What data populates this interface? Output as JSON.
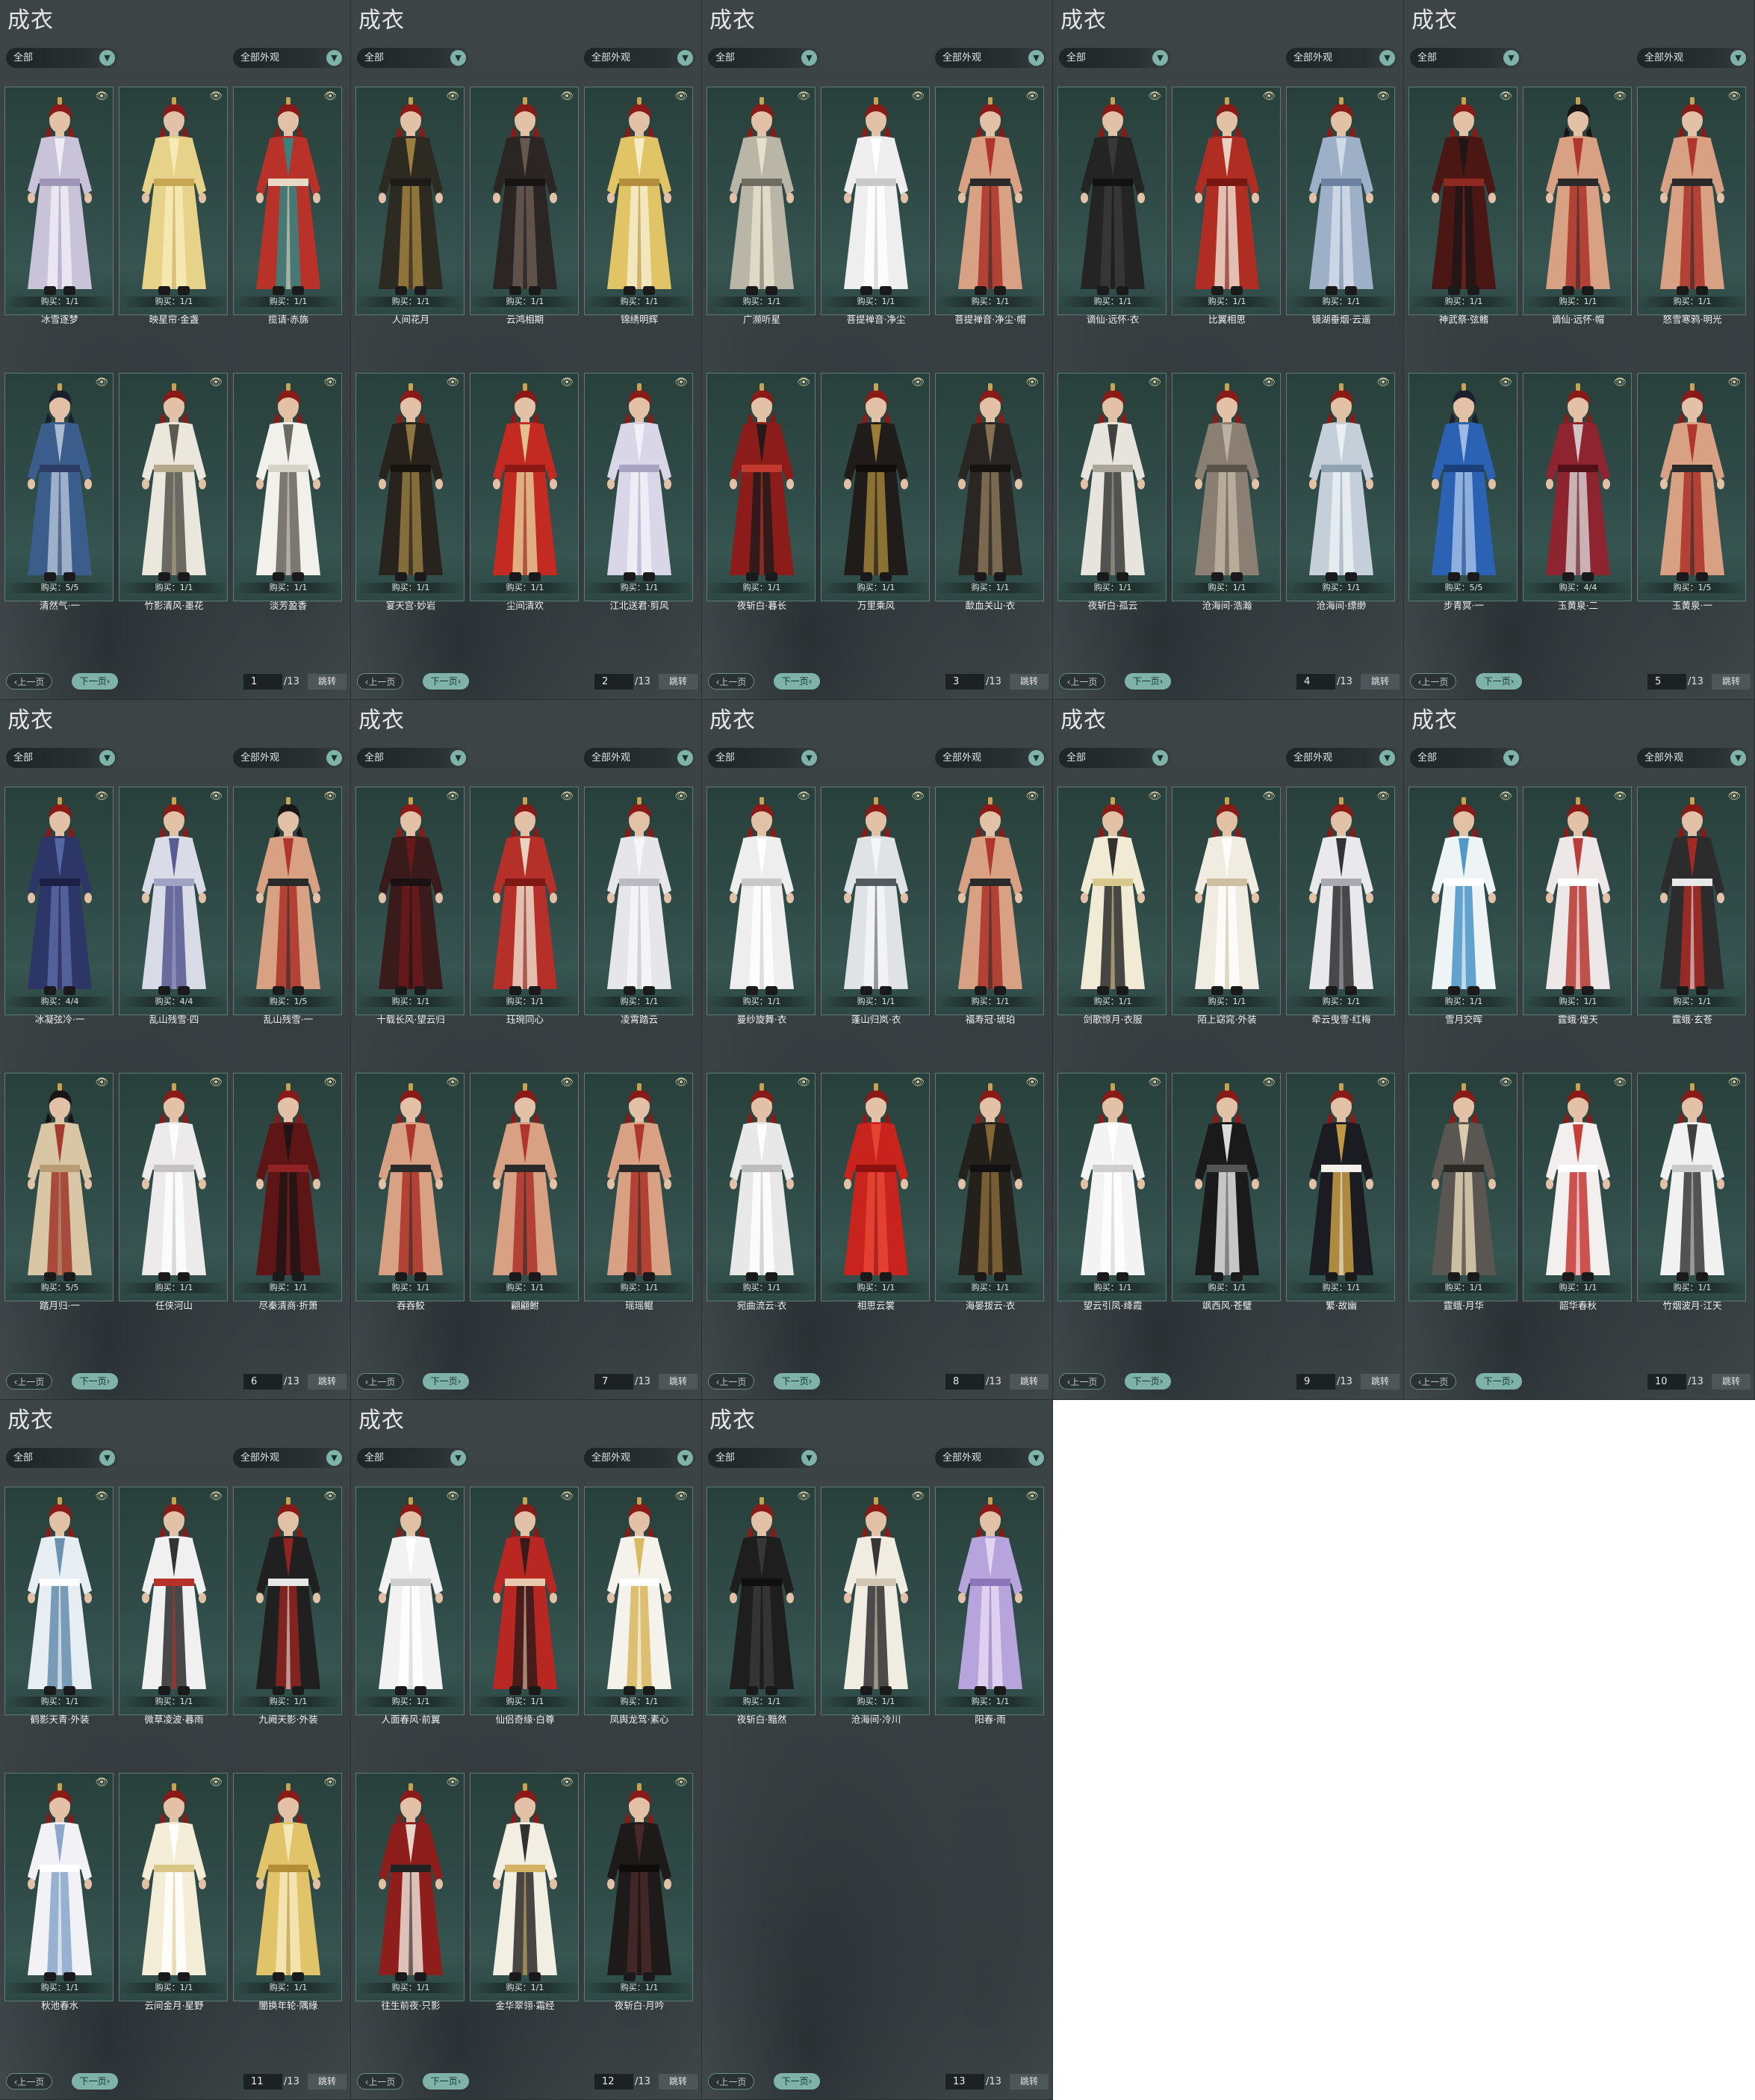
{
  "app": {
    "title": "成衣",
    "filter_left": "全部",
    "filter_right": "全部外观",
    "prev_label": "上一页",
    "next_label": "下一页",
    "jump_label": "跳转",
    "total_pages": "/13",
    "eye_icon": "eye-icon",
    "dropdown_icon": "chevron-down-icon"
  },
  "panels": [
    {
      "page": "1",
      "items": [
        {
          "name": "冰雪逐梦",
          "buy": "购买：1/1",
          "hair": "#8a1a16",
          "outfit": [
            "#c9c3d9",
            "#f1eff6",
            "#9d96b8"
          ]
        },
        {
          "name": "映星帘·金盏",
          "buy": "购买：1/1",
          "hair": "#8a1a16",
          "outfit": [
            "#e7d28a",
            "#f7ecb9",
            "#c7a754"
          ]
        },
        {
          "name": "揽请·赤旆",
          "buy": "购买：1/1",
          "hair": "#8a1a16",
          "outfit": [
            "#b8322a",
            "#2a8a86",
            "#e8d9c4"
          ]
        },
        {
          "name": "清然气·一",
          "buy": "购买：5/5",
          "hair": "#1c1f2e",
          "outfit": [
            "#3a5d8c",
            "#b7c5d8",
            "#2b3d66"
          ]
        },
        {
          "name": "竹影清风·墨花",
          "buy": "购买：1/1",
          "hair": "#8a1a16",
          "outfit": [
            "#ece7dc",
            "#4a4a44",
            "#b5a78a"
          ]
        },
        {
          "name": "淡芳盈香",
          "buy": "购买：1/1",
          "hair": "#8a1a16",
          "outfit": [
            "#f2f0ea",
            "#5c5a55",
            "#d6d2c8"
          ]
        }
      ]
    },
    {
      "page": "2",
      "items": [
        {
          "name": "人间花月",
          "buy": "购买：1/1",
          "hair": "#8a1a16",
          "outfit": [
            "#2d2a22",
            "#a68642",
            "#1d1b17"
          ]
        },
        {
          "name": "云鸿相期",
          "buy": "购买：1/1",
          "hair": "#8a1a16",
          "outfit": [
            "#2b2523",
            "#6b5e55",
            "#191515"
          ]
        },
        {
          "name": "锦绣明辉",
          "buy": "购买：1/1",
          "hair": "#8a1a16",
          "outfit": [
            "#e1c465",
            "#f6f0d2",
            "#b48e3a"
          ]
        },
        {
          "name": "宴天宫·妙岩",
          "buy": "购买：1/1",
          "hair": "#8a1a16",
          "outfit": [
            "#28231c",
            "#9a7f45",
            "#17140f"
          ]
        },
        {
          "name": "尘间清欢",
          "buy": "购买：1/1",
          "hair": "#8a1a16",
          "outfit": [
            "#c22a22",
            "#e7cf9a",
            "#8e1914"
          ]
        },
        {
          "name": "江北送君·剪风",
          "buy": "购买：1/1",
          "hair": "#8a1a16",
          "outfit": [
            "#d9d6e8",
            "#f3f2f8",
            "#a8a3c2"
          ]
        }
      ]
    },
    {
      "page": "3",
      "items": [
        {
          "name": "广濒听星",
          "buy": "购买：1/1",
          "hair": "#8a1a16",
          "outfit": [
            "#b9b6a8",
            "#e9e4cf",
            "#6f6c62"
          ]
        },
        {
          "name": "菩提禅音·净尘",
          "buy": "购买：1/1",
          "hair": "#8a1a16",
          "outfit": [
            "#eeeeee",
            "#ffffff",
            "#c9c9c9"
          ]
        },
        {
          "name": "菩提禅音·净尘·帽",
          "buy": "购买：1/1",
          "hair": "#8a1a16",
          "outfit": [
            "#d9a184",
            "#a82a22",
            "#2a2a2a"
          ]
        },
        {
          "name": "夜斩白·暮长",
          "buy": "购买：1/1",
          "hair": "#8a1a16",
          "outfit": [
            "#8b1c1a",
            "#1d1a1a",
            "#c23a2e"
          ]
        },
        {
          "name": "万里乘风",
          "buy": "购买：1/1",
          "hair": "#8a1a16",
          "outfit": [
            "#1f1c1a",
            "#a7873c",
            "#0f0e0d"
          ]
        },
        {
          "name": "歃血关山·衣",
          "buy": "购买：1/1",
          "hair": "#8a1a16",
          "outfit": [
            "#2a2624",
            "#8d7a5c",
            "#161312"
          ]
        }
      ]
    },
    {
      "page": "4",
      "items": [
        {
          "name": "谪仙·远怀·衣",
          "buy": "购买：1/1",
          "hair": "#8a1a16",
          "outfit": [
            "#242424",
            "#3b3b3b",
            "#121212"
          ]
        },
        {
          "name": "比翼相思",
          "buy": "购买：1/1",
          "hair": "#8a1a16",
          "outfit": [
            "#b02d24",
            "#efe3d3",
            "#7a1612"
          ]
        },
        {
          "name": "镜湖垂烟·云遥",
          "buy": "购买：1/1",
          "hair": "#8a1a16",
          "outfit": [
            "#9eb0c8",
            "#d6dfea",
            "#6d82a0"
          ]
        },
        {
          "name": "夜斩白·孤云",
          "buy": "购买：1/1",
          "hair": "#8a1a16",
          "outfit": [
            "#e7e4de",
            "#2d2d2d",
            "#aaa59a"
          ]
        },
        {
          "name": "沧海间·浩瀚",
          "buy": "购买：1/1",
          "hair": "#8a1a16",
          "outfit": [
            "#8a7f72",
            "#c2b7a6",
            "#5a5248"
          ]
        },
        {
          "name": "沧海间·缥缈",
          "buy": "购买：1/1",
          "hair": "#8a1a16",
          "outfit": [
            "#c4cfd9",
            "#eef2f5",
            "#91a2b2"
          ]
        }
      ]
    },
    {
      "page": "5",
      "items": [
        {
          "name": "神武祭·弦鳍",
          "buy": "购买：1/1",
          "hair": "#8a1a16",
          "outfit": [
            "#4a1714",
            "#1c1616",
            "#8f2a22"
          ]
        },
        {
          "name": "谪仙·远怀·帽",
          "buy": "购买：1/1",
          "hair": "#1a1515",
          "outfit": [
            "#d9a184",
            "#a82a22",
            "#2a2a2a"
          ]
        },
        {
          "name": "怒雪寒鸦·明光",
          "buy": "购买：1/1",
          "hair": "#8a1a16",
          "outfit": [
            "#d9a184",
            "#a82a22",
            "#2a2a2a"
          ]
        },
        {
          "name": "步青冥·一",
          "buy": "购买：5/5",
          "hair": "#1c1f2e",
          "outfit": [
            "#2c62b3",
            "#a8c4ea",
            "#1c3f7c"
          ]
        },
        {
          "name": "玉黄泉·二",
          "buy": "购买：4/4",
          "hair": "#8a1a16",
          "outfit": [
            "#8e2430",
            "#d9d6d6",
            "#541018"
          ]
        },
        {
          "name": "玉黄泉·一",
          "buy": "购买：1/5",
          "hair": "#8a1a16",
          "outfit": [
            "#d9a184",
            "#a82a22",
            "#2a2a2a"
          ]
        }
      ]
    },
    {
      "page": "6",
      "items": [
        {
          "name": "冰凝弦冷·一",
          "buy": "购买：4/4",
          "hair": "#8a1a16",
          "outfit": [
            "#2d3767",
            "#5c6aa6",
            "#1a2046"
          ]
        },
        {
          "name": "乱山残雪·四",
          "buy": "购买：4/4",
          "hair": "#8a1a16",
          "outfit": [
            "#d9dbe6",
            "#4b4f8a",
            "#9fa4c4"
          ]
        },
        {
          "name": "乱山残雪·一",
          "buy": "购买：1/5",
          "hair": "#1a1515",
          "outfit": [
            "#d9a184",
            "#a82a22",
            "#2a2a2a"
          ]
        },
        {
          "name": "踏月归·一",
          "buy": "购买：5/5",
          "hair": "#1a1515",
          "outfit": [
            "#d9c6a4",
            "#9b2a22",
            "#b79c74"
          ]
        },
        {
          "name": "任侠河山",
          "buy": "购买：1/1",
          "hair": "#8a1a16",
          "outfit": [
            "#eceaea",
            "#ffffff",
            "#c4c2c2"
          ]
        },
        {
          "name": "尽秦清商·折箫",
          "buy": "购买：1/1",
          "hair": "#8a1a16",
          "outfit": [
            "#5e1515",
            "#1a1414",
            "#8f2222"
          ]
        }
      ]
    },
    {
      "page": "7",
      "items": [
        {
          "name": "十载长风·望云归",
          "buy": "购买：1/1",
          "hair": "#8a1a16",
          "outfit": [
            "#3a1b1b",
            "#6f1a1a",
            "#1a1212"
          ]
        },
        {
          "name": "珏琬同心",
          "buy": "购买：1/1",
          "hair": "#8a1a16",
          "outfit": [
            "#b6302a",
            "#f0e4d2",
            "#7d1813"
          ]
        },
        {
          "name": "凌霄踏云",
          "buy": "购买：1/1",
          "hair": "#8a1a16",
          "outfit": [
            "#e6e6ea",
            "#f8f8fa",
            "#babac2"
          ]
        },
        {
          "name": "吞吞鲛",
          "buy": "购买：1/1",
          "hair": "#8a1a16",
          "outfit": [
            "#d9a184",
            "#a82a22",
            "#2a2a2a"
          ]
        },
        {
          "name": "翩翩鲋",
          "buy": "购买：1/1",
          "hair": "#8a1a16",
          "outfit": [
            "#d9a184",
            "#a82a22",
            "#2a2a2a"
          ]
        },
        {
          "name": "瑶瑶鲲",
          "buy": "购买：1/1",
          "hair": "#8a1a16",
          "outfit": [
            "#d9a184",
            "#a82a22",
            "#2a2a2a"
          ]
        }
      ]
    },
    {
      "page": "8",
      "items": [
        {
          "name": "曼纱旋舞·衣",
          "buy": "购买：1/1",
          "hair": "#8a1a16",
          "outfit": [
            "#eeeeee",
            "#ffffff",
            "#c8c8c8"
          ]
        },
        {
          "name": "蓬山归岚·衣",
          "buy": "购买：1/1",
          "hair": "#8a1a16",
          "outfit": [
            "#dfe3e6",
            "#f5f6f7",
            "#535a60"
          ]
        },
        {
          "name": "福寿冠·琥珀",
          "buy": "购买：1/1",
          "hair": "#8a1a16",
          "outfit": [
            "#d9a184",
            "#a82a22",
            "#2a2a2a"
          ]
        },
        {
          "name": "宛曲流云·衣",
          "buy": "购买：1/1",
          "hair": "#8a1a16",
          "outfit": [
            "#e8e8e8",
            "#ffffff",
            "#bdbdbd"
          ]
        },
        {
          "name": "相思云裳",
          "buy": "购买：1/1",
          "hair": "#8a1a16",
          "outfit": [
            "#c8231d",
            "#e84838",
            "#8d120f"
          ]
        },
        {
          "name": "海晏拔云·衣",
          "buy": "购买：1/1",
          "hair": "#8a1a16",
          "outfit": [
            "#24201c",
            "#8c6d3b",
            "#121010"
          ]
        }
      ]
    },
    {
      "page": "9",
      "items": [
        {
          "name": "剑歌惊月·衣服",
          "buy": "购买：1/1",
          "hair": "#8a1a16",
          "outfit": [
            "#f1ead4",
            "#1d1d1d",
            "#d9c88e"
          ]
        },
        {
          "name": "陌上窈窕·外装",
          "buy": "购买：1/1",
          "hair": "#8a1a16",
          "outfit": [
            "#f1ece2",
            "#ffffff",
            "#cdbf9f"
          ]
        },
        {
          "name": "牵云曳雪·红梅",
          "buy": "购买：1/1",
          "hair": "#8a1a16",
          "outfit": [
            "#e9e9ec",
            "#1f1f22",
            "#a9a9b2"
          ]
        },
        {
          "name": "望云引凤·绛霞",
          "buy": "购买：1/1",
          "hair": "#8a1a16",
          "outfit": [
            "#f3f3f3",
            "#ffffff",
            "#cfcfcf"
          ]
        },
        {
          "name": "飒西风·苍璧",
          "buy": "购买：1/1",
          "hair": "#8a1a16",
          "outfit": [
            "#1a1a1a",
            "#f1f1f1",
            "#555555"
          ]
        },
        {
          "name": "繁·故幽",
          "buy": "购买：1/1",
          "hair": "#8a1a16",
          "outfit": [
            "#1b1b22",
            "#d3a648",
            "#f2efe8"
          ]
        }
      ]
    },
    {
      "page": "10",
      "items": [
        {
          "name": "雪月交晖",
          "buy": "购买：1/1",
          "hair": "#8a1a16",
          "outfit": [
            "#eef3f6",
            "#3f8fc4",
            "#ffffff"
          ]
        },
        {
          "name": "霆蛾·煌天",
          "buy": "购买：1/1",
          "hair": "#8a1a16",
          "outfit": [
            "#eee7e7",
            "#b22a26",
            "#ffffff"
          ]
        },
        {
          "name": "霆蛾·玄苍",
          "buy": "购买：1/1",
          "hair": "#8a1a16",
          "outfit": [
            "#2c2c2c",
            "#b22a26",
            "#e7e7e7"
          ]
        },
        {
          "name": "霆蛾·月华",
          "buy": "购买：1/1",
          "hair": "#8a1a16",
          "outfit": [
            "#5a5752",
            "#e7d8b6",
            "#2d2a26"
          ]
        },
        {
          "name": "韶华春秋",
          "buy": "购买：1/1",
          "hair": "#8a1a16",
          "outfit": [
            "#f3efef",
            "#c02b25",
            "#ffffff"
          ]
        },
        {
          "name": "竹烟波月·江天",
          "buy": "购买：1/1",
          "hair": "#8a1a16",
          "outfit": [
            "#f1f1f1",
            "#2b2b2b",
            "#c9c9c9"
          ]
        }
      ]
    },
    {
      "page": "11",
      "items": [
        {
          "name": "鹤影天青·外装",
          "buy": "购买：1/1",
          "hair": "#8a1a16",
          "outfit": [
            "#e6eef4",
            "#5c86a8",
            "#ffffff"
          ]
        },
        {
          "name": "微草凌波·暮雨",
          "buy": "购买：1/1",
          "hair": "#8a1a16",
          "outfit": [
            "#f0f0f0",
            "#1e1e1e",
            "#b8302a"
          ]
        },
        {
          "name": "九阙天影·外装",
          "buy": "购买：1/1",
          "hair": "#8a1a16",
          "outfit": [
            "#202020",
            "#9a2620",
            "#e6e6e6"
          ]
        },
        {
          "name": "秋池春水",
          "buy": "购买：1/1",
          "hair": "#8a1a16",
          "outfit": [
            "#f2f2f6",
            "#7fa0c8",
            "#ffffff"
          ]
        },
        {
          "name": "云间金月·星野",
          "buy": "购买：1/1",
          "hair": "#8a1a16",
          "outfit": [
            "#f3edd8",
            "#ffffff",
            "#d9c687"
          ]
        },
        {
          "name": "闇换年轮·隅綠",
          "buy": "购买：1/1",
          "hair": "#8a1a16",
          "outfit": [
            "#e1c36a",
            "#f7ebc1",
            "#b38d36"
          ]
        }
      ]
    },
    {
      "page": "12",
      "items": [
        {
          "name": "人面春风·前翼",
          "buy": "购买：1/1",
          "hair": "#8a1a16",
          "outfit": [
            "#f2f2f2",
            "#ffffff",
            "#cfcfcf"
          ]
        },
        {
          "name": "仙侣奇缘·白尊",
          "buy": "购买：1/1",
          "hair": "#8a1a16",
          "outfit": [
            "#b92722",
            "#2a1a1a",
            "#e8c9b0"
          ]
        },
        {
          "name": "凤舆龙驾·素心",
          "buy": "购买：1/1",
          "hair": "#8a1a16",
          "outfit": [
            "#f4f2ea",
            "#d6b253",
            "#ffffff"
          ]
        },
        {
          "name": "往生前夜·只影",
          "buy": "购买：1/1",
          "hair": "#8a1a16",
          "outfit": [
            "#8e1e1c",
            "#f1e9de",
            "#222222"
          ]
        },
        {
          "name": "金华翠翎·霜经",
          "buy": "购买：1/1",
          "hair": "#8a1a16",
          "outfit": [
            "#f2eee2",
            "#1c1c1c",
            "#d5b266"
          ]
        },
        {
          "name": "夜斩白·月吟",
          "buy": "购买：1/1",
          "hair": "#8a1a16",
          "outfit": [
            "#1e1a1a",
            "#4a2a2a",
            "#0f0c0c"
          ]
        }
      ]
    },
    {
      "page": "13",
      "items": [
        {
          "name": "夜斩白·黯然",
          "buy": "购买：1/1",
          "hair": "#8a1a16",
          "outfit": [
            "#1e1e1e",
            "#3a3a3a",
            "#0f0f0f"
          ]
        },
        {
          "name": "沧海间·冷川",
          "buy": "购买：1/1",
          "hair": "#8a1a16",
          "outfit": [
            "#f0ece2",
            "#222222",
            "#cfc7b3"
          ]
        },
        {
          "name": "阳春·雨",
          "buy": "购买：1/1",
          "hair": "#8a1a16",
          "outfit": [
            "#b8a4dc",
            "#e6dcf4",
            "#8c74b8"
          ]
        }
      ]
    }
  ]
}
